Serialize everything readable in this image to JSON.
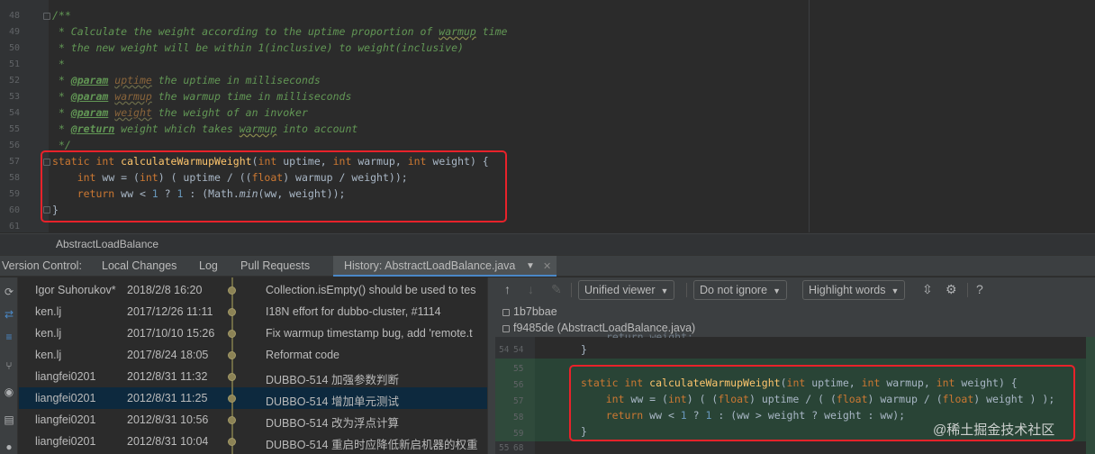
{
  "editor": {
    "line_numbers": [
      "48",
      "49",
      "50",
      "51",
      "52",
      "53",
      "54",
      "55",
      "56",
      "57",
      "58",
      "59",
      "60",
      "61"
    ],
    "doc": {
      "open": "/**",
      "l1_a": " * Calculate the weight according to the uptime proportion of ",
      "l1_u": "warmup",
      "l1_b": " time",
      "l2": " * the new weight will be within 1(inclusive) to weight(inclusive)",
      "l3": " *",
      "p1_tag": "@param",
      "p1_name": "uptime",
      "p1_desc": " the uptime in milliseconds",
      "p2_tag": "@param",
      "p2_name": "warmup",
      "p2_desc": " the warmup time in milliseconds",
      "p3_tag": "@param",
      "p3_name": "weight",
      "p3_desc": " the weight of an invoker",
      "r_tag": "@return",
      "r_desc_a": " weight which takes ",
      "r_u": "warmup",
      "r_desc_b": " into account",
      "close": " */"
    },
    "code": {
      "l57_kw": "static int ",
      "l57_fn": "calculateWarmupWeight",
      "l57_p1": "(",
      "l57_k1": "int ",
      "l57_p2": "uptime, ",
      "l57_k2": "int ",
      "l57_p3": "warmup, ",
      "l57_k3": "int ",
      "l57_p4": "weight) {",
      "l58_kw": "    int ",
      "l58_a": "ww = (",
      "l58_k": "int",
      "l58_b": ") ( uptime / ((",
      "l58_k2": "float",
      "l58_c": ") warmup / weight));",
      "l59_kw": "    return ",
      "l59_a": "ww < ",
      "l59_n1": "1",
      "l59_b": " ? ",
      "l59_n2": "1",
      "l59_c": " : (Math.",
      "l59_i": "min",
      "l59_d": "(ww, weight));",
      "l60": "}"
    },
    "breadcrumb": "AbstractLoadBalance"
  },
  "tabs": {
    "label": "Version Control:",
    "local_changes": "Local Changes",
    "log": "Log",
    "pull_requests": "Pull Requests",
    "history": "History: AbstractLoadBalance.java"
  },
  "commits": [
    {
      "author": "Igor Suhorukov*",
      "date": "2018/2/8 16:20",
      "message": "Collection.isEmpty() should be used to tes"
    },
    {
      "author": "ken.lj",
      "date": "2017/12/26 11:11",
      "message": "I18N effort for dubbo-cluster, #1114"
    },
    {
      "author": "ken.lj",
      "date": "2017/10/10 15:26",
      "message": "Fix warmup timestamp bug, add 'remote.t"
    },
    {
      "author": "ken.lj",
      "date": "2017/8/24 18:05",
      "message": "Reformat code"
    },
    {
      "author": "liangfei0201",
      "date": "2012/8/31 11:32",
      "message": "DUBBO-514 加强参数判断"
    },
    {
      "author": "liangfei0201",
      "date": "2012/8/31 11:25",
      "message": "DUBBO-514 增加单元测试"
    },
    {
      "author": "liangfei0201",
      "date": "2012/8/31 10:56",
      "message": "DUBBO-514 改为浮点计算"
    },
    {
      "author": "liangfei0201",
      "date": "2012/8/31 10:04",
      "message": "DUBBO-514 重启时应降低新启机器的权重"
    }
  ],
  "diff": {
    "viewer": "Unified viewer",
    "ignore": "Do not ignore",
    "highlight": "Highlight words",
    "help": "?",
    "rev1": "1b7bbae",
    "rev2": "f9485de (AbstractLoadBalance.java)",
    "gutter": [
      {
        "left": "54",
        "right": "54"
      },
      {
        "left": "",
        "right": "55"
      },
      {
        "left": "",
        "right": "56"
      },
      {
        "left": "",
        "right": "57"
      },
      {
        "left": "",
        "right": "58"
      },
      {
        "left": "",
        "right": "59"
      },
      {
        "left": "55",
        "right": "68"
      }
    ],
    "cut_line": "return weight;",
    "brace": "}",
    "code": {
      "l56_kw": "static int ",
      "l56_fn": "calculateWarmupWeight",
      "l56_p1": "(",
      "l56_k1": "int ",
      "l56_p2": "uptime, ",
      "l56_k2": "int ",
      "l56_p3": "warmup, ",
      "l56_k3": "int ",
      "l56_p4": "weight) {",
      "l57_kw": "    int ",
      "l57_a": "ww = (",
      "l57_k": "int",
      "l57_b": ") ( (",
      "l57_k2": "float",
      "l57_c": ") uptime / ( (",
      "l57_k3": "float",
      "l57_d": ") warmup / (",
      "l57_k4": "float",
      "l57_e": ") weight ) );",
      "l58_kw": "    return ",
      "l58_a": "ww < ",
      "l58_n1": "1",
      "l58_b": " ? ",
      "l58_n2": "1",
      "l58_c": " : (ww > weight ? weight : ww);",
      "l59": "}"
    }
  },
  "watermark": "@稀土掘金技术社区",
  "colors": {
    "keyword": "#cc7832",
    "function": "#ffc66d",
    "comment": "#629755",
    "selection": "#0d293e",
    "added": "#294436",
    "highlight_box": "#e8222a"
  }
}
